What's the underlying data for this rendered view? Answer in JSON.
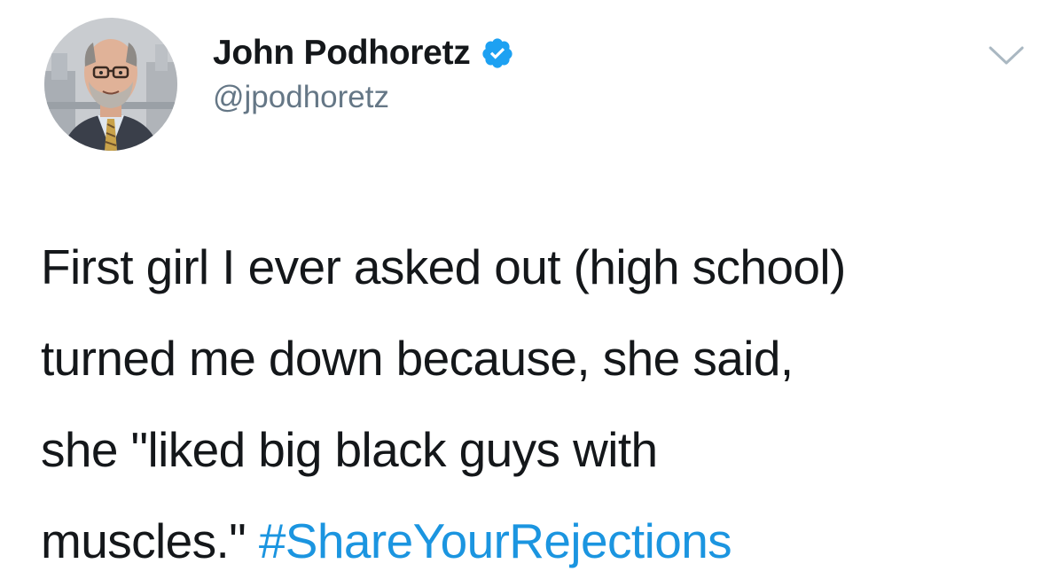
{
  "author": {
    "display_name": "John Podhoretz",
    "handle": "@jpodhoretz",
    "verified": true
  },
  "tweet": {
    "lines": [
      "First girl I ever asked out (high school)",
      "turned me down because, she said,",
      "she \"liked big black guys with",
      "muscles.\""
    ],
    "hashtag": "#ShareYourRejections"
  },
  "icons": {
    "verified_badge": "verified-check-icon",
    "menu": "chevron-down-icon"
  },
  "colors": {
    "text": "#14171a",
    "secondary_text": "#657786",
    "link": "#1b95e0",
    "verified_badge": "#1da1f2",
    "background": "#ffffff"
  }
}
